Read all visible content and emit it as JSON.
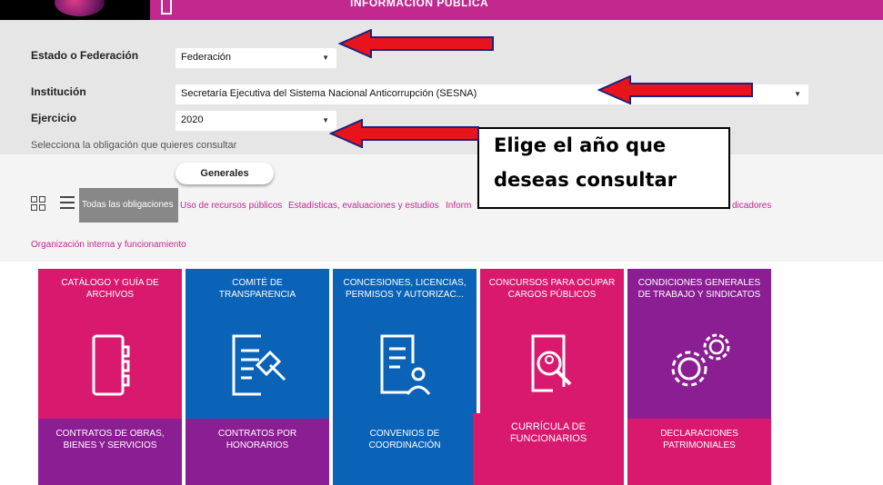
{
  "header": {
    "title": "INFORMACIÓN PÚBLICA"
  },
  "form": {
    "state_label": "Estado o Federación",
    "state_value": "Federación",
    "institution_label": "Institución",
    "institution_value": "Secretaría Ejecutiva del Sistema Nacional Anticorrupción (SESNA)",
    "year_label": "Ejercicio",
    "year_value": "2020",
    "prompt": "Selecciona la obligación que quieres consultar"
  },
  "obligations": {
    "pill": "Generales",
    "filters": [
      "Todas las obligaciones",
      "Uso de recursos públicos",
      "Estadísticas, evaluaciones y estudios",
      "Inform",
      "dicadores",
      "Organización interna y funcionamiento"
    ]
  },
  "tiles": [
    {
      "title": "CATÁLOGO Y GUÍA DE ARCHIVOS",
      "color": "#d9196e",
      "icon": "binder-icon"
    },
    {
      "title": "COMITÉ DE TRANSPARENCIA",
      "color": "#0b63b8",
      "icon": "document-gavel-icon"
    },
    {
      "title": "CONCESIONES, LICENCIAS, PERMISOS Y AUTORIZAC...",
      "color": "#0b63b8",
      "icon": "document-person-icon"
    },
    {
      "title": "CONCURSOS PARA OCUPAR CARGOS PÚBLICOS",
      "color": "#d9196e",
      "icon": "document-search-icon"
    },
    {
      "title": "CONDICIONES GENERALES DE TRABAJO Y SINDICATOS",
      "color": "#8b1e93",
      "icon": "gears-icon"
    },
    {
      "title": "CONTRATOS DE OBRAS, BIENES Y SERVICIOS",
      "color": "#8b1e93",
      "icon": ""
    },
    {
      "title": "CONTRATOS POR HONORARIOS",
      "color": "#8b1e93",
      "icon": ""
    },
    {
      "title": "CONVENIOS DE COORDINACIÓN",
      "color": "#0b63b8",
      "icon": ""
    },
    {
      "title": "CURRÍCULA DE FUNCIONARIOS",
      "color": "#d9196e",
      "icon": ""
    },
    {
      "title": "DECLARACIONES PATRIMONIALES",
      "color": "#d9196e",
      "icon": ""
    }
  ],
  "annotation": {
    "line1": "Elige el año que",
    "line2": "deseas consultar",
    "arrow_color": "#e8141b"
  }
}
